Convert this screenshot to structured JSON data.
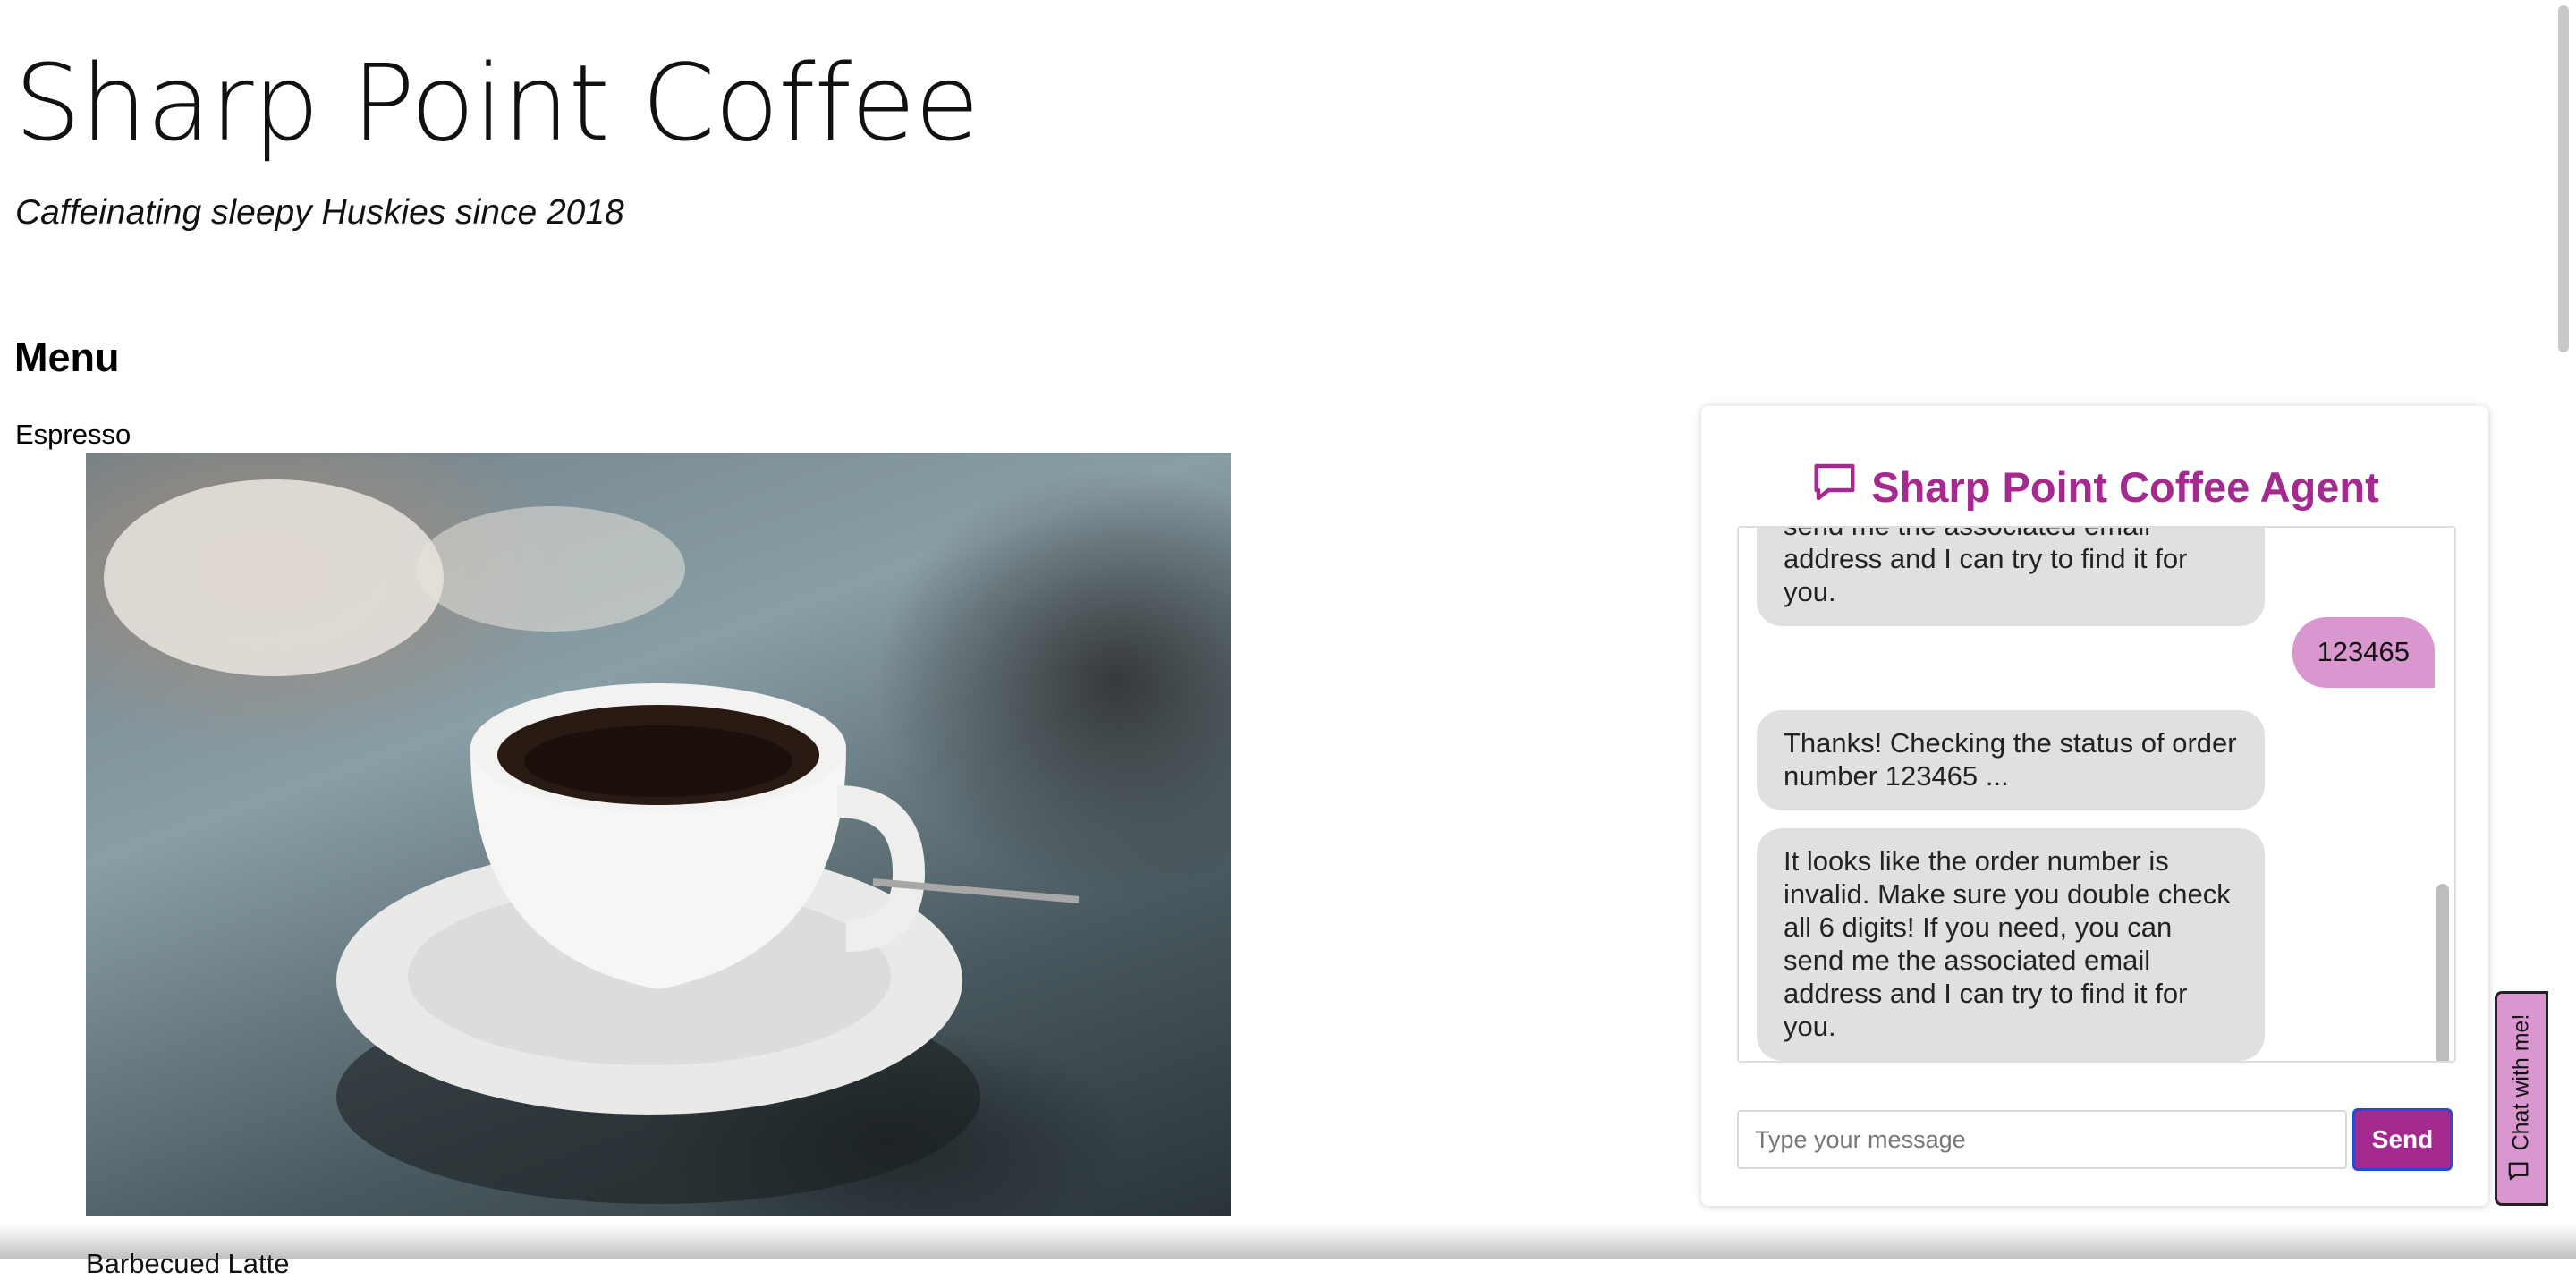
{
  "site": {
    "title": "Sharp Point Coffee",
    "tagline": "Caffeinating sleepy Huskies since 2018"
  },
  "menu": {
    "heading": "Menu",
    "items": [
      {
        "name": "Espresso",
        "image_icon": "coffee-cup-photo"
      },
      {
        "name": "Barbecued Latte"
      }
    ]
  },
  "chat": {
    "header_title": "Sharp Point Coffee Agent",
    "header_icon": "chat-bubble-icon",
    "messages": [
      {
        "sender": "bot",
        "text": "It looks like the order number is invalid. Make sure you double check all 6 digits! If you need, you can send me the associated email address and I can try to find it for you."
      },
      {
        "sender": "user",
        "text": "123465"
      },
      {
        "sender": "bot",
        "text": "Thanks! Checking the status of order number 123465 ..."
      },
      {
        "sender": "bot",
        "text": "It looks like the order number is invalid. Make sure you double check all 6 digits! If you need, you can send me the associated email address and I can try to find it for you."
      }
    ],
    "input_placeholder": "Type your message",
    "send_label": "Send",
    "tab_label": "Chat with me!",
    "tab_icon": "chat-bubble-icon"
  },
  "colors": {
    "brand": "#a52a8f",
    "user_bubble": "#d996cf",
    "bot_bubble": "#e0e0e0",
    "send_border": "#2d49c9"
  }
}
